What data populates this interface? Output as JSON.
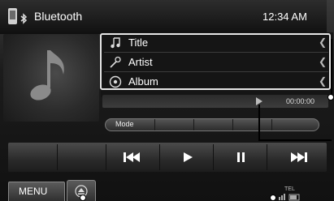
{
  "header": {
    "title": "Bluetooth",
    "time": "12:34 AM"
  },
  "icons": {
    "bluetooth": "phone-bluetooth-icon",
    "artwork": "music-note-icon",
    "title": "music-note-small-icon",
    "artist": "microphone-icon",
    "album": "disc-icon"
  },
  "track": {
    "title": "Title",
    "artist": "Artist",
    "album": "Album",
    "elapsed": "00:00:00"
  },
  "mode_label": "Mode",
  "controls": [
    "previous",
    "play",
    "pause",
    "next"
  ],
  "bottom": {
    "menu_label": "MENU",
    "tel_label": "TEL"
  }
}
